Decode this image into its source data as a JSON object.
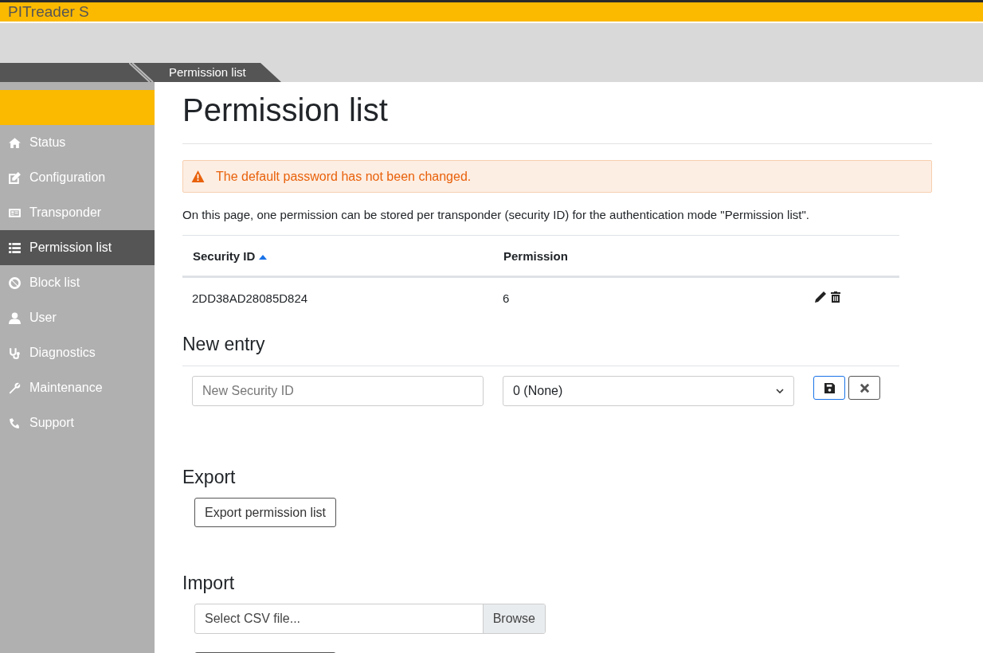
{
  "app": {
    "title": "PITreader S"
  },
  "breadcrumb": {
    "current": "Permission list"
  },
  "sidebar": {
    "items": [
      {
        "kind": "home",
        "label": "Status",
        "selected": false
      },
      {
        "kind": "edit",
        "label": "Configuration",
        "selected": false
      },
      {
        "kind": "card",
        "label": "Transponder",
        "selected": false
      },
      {
        "kind": "list",
        "label": "Permission list",
        "selected": true
      },
      {
        "kind": "ban",
        "label": "Block list",
        "selected": false
      },
      {
        "kind": "user",
        "label": "User",
        "selected": false
      },
      {
        "kind": "stethoscope",
        "label": "Diagnostics",
        "selected": false
      },
      {
        "kind": "wrench",
        "label": "Maintenance",
        "selected": false
      },
      {
        "kind": "phone",
        "label": "Support",
        "selected": false
      }
    ]
  },
  "page": {
    "title": "Permission list"
  },
  "alert": {
    "kind": "warning",
    "text": "The default password has not been changed."
  },
  "intro": "On this page, one permission can be stored per transponder (security ID) for the authentication mode \"Permission list\".",
  "table": {
    "columns": [
      {
        "label": "Security ID",
        "sorted": true
      },
      {
        "label": "Permission",
        "sorted": false
      }
    ],
    "rows": [
      {
        "security_id": "2DD38AD28085D824",
        "permission": "6"
      }
    ]
  },
  "new_entry": {
    "heading": "New entry",
    "security_id": {
      "placeholder": "New Security ID"
    },
    "permission": {
      "value": "0 (None)"
    }
  },
  "export": {
    "heading": "Export",
    "button": "Export permission list"
  },
  "import": {
    "heading": "Import",
    "file": {
      "placeholder": "Select CSV file...",
      "button": "Browse"
    }
  }
}
